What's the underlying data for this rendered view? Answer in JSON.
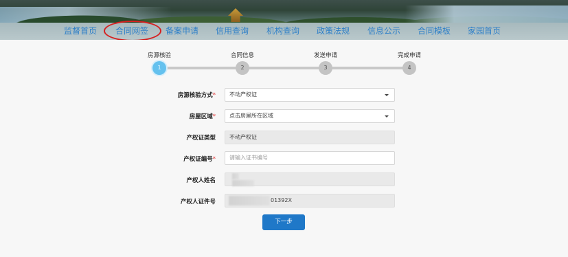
{
  "nav": {
    "items": [
      {
        "label": "监督首页"
      },
      {
        "label": "合同网签",
        "highlighted": true
      },
      {
        "label": "备案申请"
      },
      {
        "label": "信用查询"
      },
      {
        "label": "机构查询"
      },
      {
        "label": "政策法规"
      },
      {
        "label": "信息公示"
      },
      {
        "label": "合同模板"
      },
      {
        "label": "家园首页"
      }
    ],
    "highlight_color": "#d61f1f"
  },
  "stepper": {
    "active_index": 0,
    "steps": [
      {
        "label": "房源核验",
        "number": "1"
      },
      {
        "label": "合同信息",
        "number": "2"
      },
      {
        "label": "发送申请",
        "number": "3"
      },
      {
        "label": "完成申请",
        "number": "4"
      }
    ]
  },
  "form": {
    "verify_method": {
      "label": "房源核验方式",
      "required_mark": "*",
      "value": "不动产权证"
    },
    "house_area": {
      "label": "房屋区域",
      "required_mark": "*",
      "value": "点击房屋所在区域"
    },
    "cert_type": {
      "label": "产权证类型",
      "value": "不动产权证"
    },
    "cert_number": {
      "label": "产权证编号",
      "required_mark": "*",
      "placeholder": "请输入证书编号"
    },
    "owner_name": {
      "label": "产权人姓名",
      "value": ""
    },
    "owner_id": {
      "label": "产权人证件号",
      "value_suffix": "01392X"
    }
  },
  "buttons": {
    "next": "下一步"
  },
  "colors": {
    "accent": "#1f78c8",
    "nav_text": "#2d7fc8",
    "required": "#e02b2b",
    "step_active": "#64c1ee"
  }
}
